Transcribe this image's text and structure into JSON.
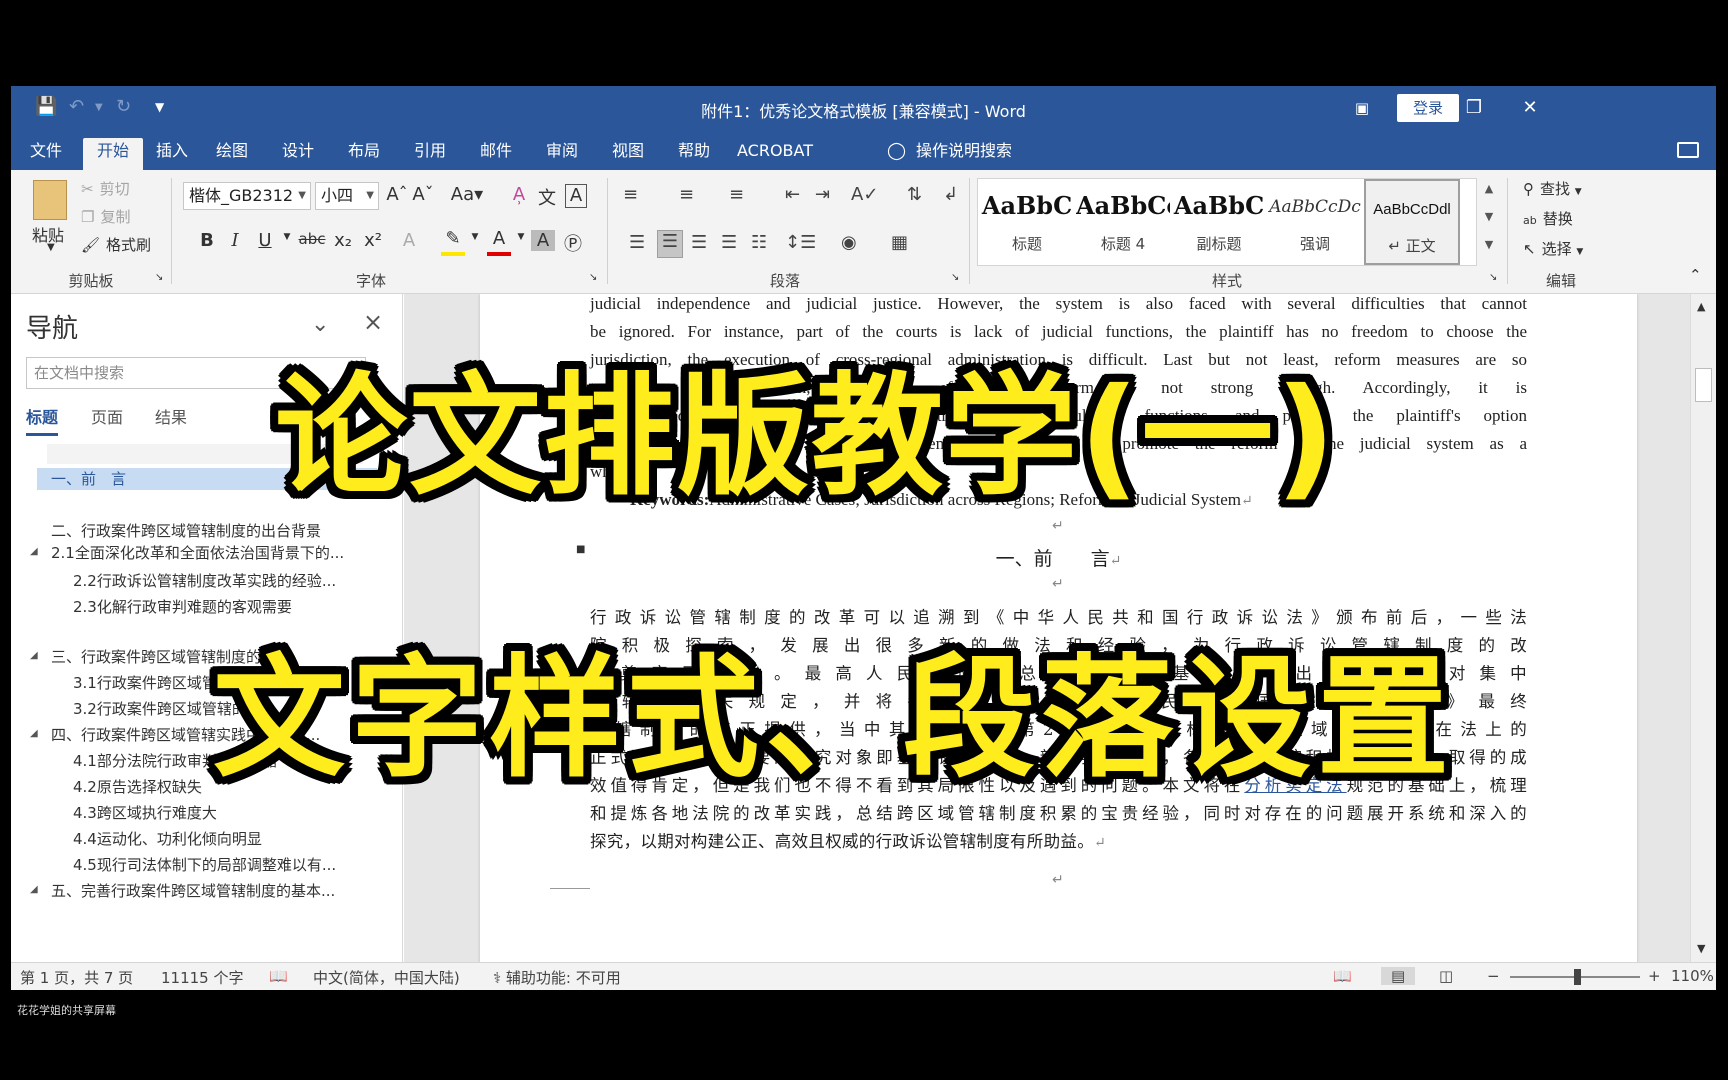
{
  "window": {
    "title": "附件1：优秀论文格式模板 [兼容模式]  -  Word",
    "login_label": "登录",
    "controls": [
      "ribbon-display-icon",
      "minimize-icon",
      "restore-icon",
      "close-icon"
    ]
  },
  "menu": {
    "tabs": [
      "文件",
      "开始",
      "插入",
      "绘图",
      "设计",
      "布局",
      "引用",
      "邮件",
      "审阅",
      "视图",
      "帮助",
      "ACROBAT"
    ],
    "active_tab": "开始",
    "tell_me": "操作说明搜索"
  },
  "ribbon": {
    "clipboard": {
      "paste": "粘贴",
      "cut": "剪切",
      "copy": "复制",
      "format_painter": "格式刷",
      "label": "剪贴板"
    },
    "font": {
      "font_name": "楷体_GB2312",
      "font_size": "小四",
      "label": "字体"
    },
    "paragraph": {
      "label": "段落"
    },
    "styles": {
      "items": [
        {
          "sample": "AaBbC",
          "name": "标题"
        },
        {
          "sample": "AaBbCc",
          "name": "标题 4"
        },
        {
          "sample": "AaBbC",
          "name": "副标题"
        },
        {
          "sample": "AaBbCcDc",
          "name": "强调"
        },
        {
          "sample": "AaBbCcDdl",
          "name": "↵ 正文"
        }
      ],
      "label": "样式"
    },
    "editing": {
      "find": "查找",
      "replace": "替换",
      "select": "选择",
      "label": "编辑"
    }
  },
  "nav": {
    "title": "导航",
    "search_placeholder": "在文档中搜索",
    "tabs": [
      "标题",
      "页面",
      "结果"
    ],
    "active_tab": "标题",
    "items": [
      "一、前　言",
      "二、行政案件跨区域管辖制度的出台背景",
      "2.1全面深化改革和全面依法治国背景下的...",
      "2.2行政诉讼管辖制度改革实践的经验...",
      "2.3化解行政审判难题的客观需要",
      "三、行政案件跨区域管辖制度的...",
      "3.1行政案件跨区域管辖的...",
      "3.2行政案件跨区域管辖的...",
      "四、行政案件跨区域管辖实践中存在的...",
      "4.1部分法院行政审判功能萎缩",
      "4.2原告选择权缺失",
      "4.3跨区域执行难度大",
      "4.4运动化、功利化倾向明显",
      "4.5现行司法体制下的局部调整难以有...",
      "五、完善行政案件跨区域管辖制度的基本..."
    ]
  },
  "document": {
    "abstract_lines": [
      "judicial independence and judicial justice. However, the system is also faced with several difficulties that cannot",
      "be ignored. For instance, part of the courts is lack of judicial functions, the plaintiff has no freedom to choose the",
      "jurisdiction, the execution of cross-regional administration is difficult. Last but not least, reform measures are so",
      "temporary and utilitarian, and the effect of reform is not strong enough. Accordingly, it is",
      "recommended to strengthen the administration and regulatory functions, and protect the plaintiff's option",
      "rights, and coordinate the supporting system to implement and promote the reform of the judicial system as a",
      "whole."
    ],
    "keywords_label": "Keywords:",
    "keywords_text": "Administrative Cases; Jurisdiction across Regions; Reform of Judicial System",
    "heading": "一、前　　言",
    "body_lines": [
      "行政诉讼管辖制度的改革可以追溯到《中华人民共和国行政诉讼法》颁布前后，一些法",
      "院积极探索，发展出很多新的做法和经验，为行政诉讼管辖制度的改",
      "革奠定了基础。最高人民法院在总结经验的基础上，出台了关于对集中",
      "管辖的相关规定，并将各经验为《中华人民共和国行政诉讼法》最终",
      "管辖制度的修正提供，当中其中第18条第2款的规定，标志着跨区域管辖制度在法上的",
      "正式确立。本文主要的研究对象即基于该款规定。新法实行以来，各级人民法院积极试点摸索，取得的成",
      "效值得肯定，但是我们也不得不看到其局限性以及遇到的问题。本文将在分析实定法规范的基础上，梳理",
      "和提炼各地法院的改革实践，总结跨区域管辖制度积累的宝贵经验，同时对存在的问题展开系统和深入的",
      "探究，以期对构建公正、高效且权威的行政诉讼管辖制度有所助益。"
    ],
    "link_text": "分析实定法"
  },
  "status": {
    "page": "第 1 页，共 7 页",
    "words": "11115 个字",
    "language": "中文(简体，中国大陆)",
    "accessibility": "辅助功能: 不可用",
    "zoom": "110%",
    "zoom_minus": "−",
    "zoom_plus": "+"
  },
  "caption": "花花学姐的共享屏幕",
  "overlay": {
    "line1": "论文排版教学(一)",
    "line2": "文字样式、段落设置"
  },
  "colors": {
    "word_blue": "#2b579a",
    "overlay_yellow": "#ffec1c",
    "ribbon_bg": "#f3f3f3"
  }
}
